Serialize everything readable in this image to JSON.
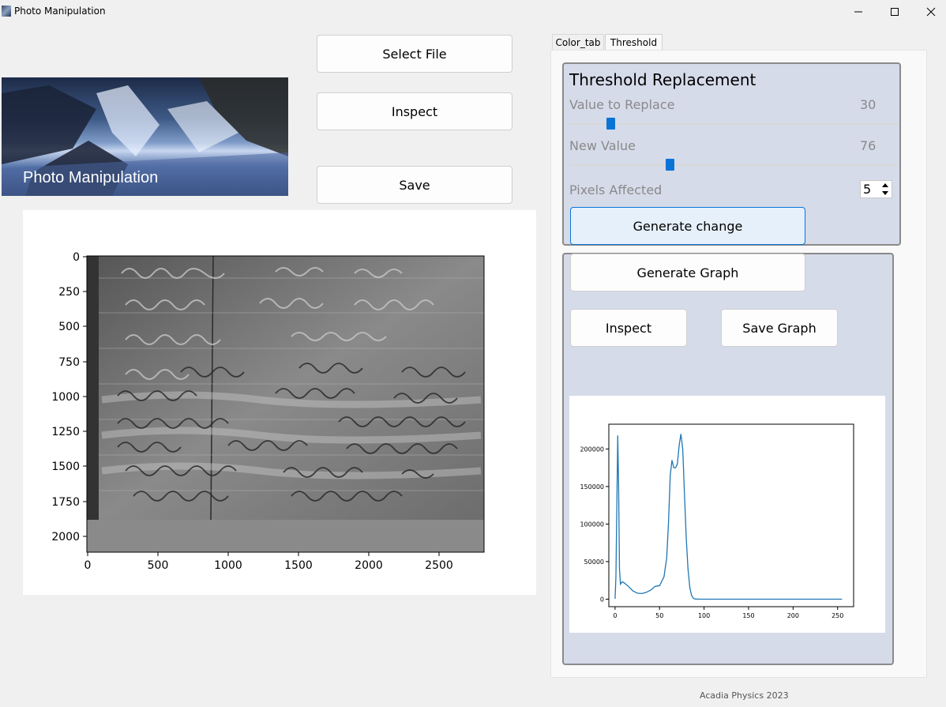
{
  "window": {
    "title": "Photo Manipulation"
  },
  "left": {
    "select_file_label": "Select File",
    "inspect_label": "Inspect",
    "save_label": "Save",
    "banner_text": "Photo Manipulation"
  },
  "image_plot": {
    "y_ticks": [
      "0",
      "250",
      "500",
      "750",
      "1000",
      "1250",
      "1500",
      "1750",
      "2000"
    ],
    "x_ticks": [
      "0",
      "500",
      "1000",
      "1500",
      "2000",
      "2500"
    ]
  },
  "tabs": [
    {
      "label": "Color_tab"
    },
    {
      "label": "Threshold"
    }
  ],
  "threshold": {
    "title": "Threshold Replacement",
    "value_to_replace_label": "Value to Replace",
    "value_to_replace": "30",
    "new_value_label": "New Value",
    "new_value": "76",
    "pixels_affected_label": "Pixels Affected",
    "pixels_affected": "5",
    "generate_change_label": "Generate change"
  },
  "graph": {
    "generate_graph_label": "Generate Graph",
    "inspect_label": "Inspect",
    "save_graph_label": "Save Graph"
  },
  "chart_data": {
    "type": "line",
    "title": "",
    "xlabel": "",
    "ylabel": "",
    "xlim": [
      -7,
      268
    ],
    "ylim": [
      -10000,
      233000
    ],
    "x_ticks": [
      "0",
      "50",
      "100",
      "150",
      "200",
      "250"
    ],
    "y_ticks": [
      "0",
      "50000",
      "100000",
      "150000",
      "200000"
    ],
    "series": [
      {
        "color": "#1f77b4",
        "x": [
          0,
          1,
          2,
          3,
          4,
          5,
          6,
          8,
          10,
          15,
          20,
          25,
          30,
          35,
          40,
          45,
          50,
          55,
          58,
          60,
          62,
          64,
          66,
          68,
          70,
          72,
          74,
          76,
          78,
          80,
          82,
          84,
          86,
          88,
          90,
          95,
          100,
          150,
          200,
          255
        ],
        "y": [
          500,
          30000,
          120000,
          218000,
          150000,
          40000,
          20000,
          23000,
          22000,
          17000,
          11000,
          8000,
          7500,
          9000,
          12000,
          17000,
          18000,
          30000,
          55000,
          100000,
          165000,
          185000,
          175000,
          175000,
          180000,
          205000,
          220000,
          200000,
          140000,
          80000,
          40000,
          15000,
          5000,
          1000,
          200,
          0,
          0,
          0,
          0,
          0
        ]
      }
    ]
  }
}
